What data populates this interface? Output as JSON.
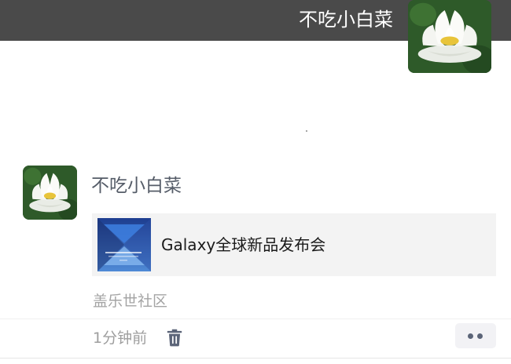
{
  "cover": {
    "name": "不吃小白菜",
    "avatar_icon": "white-lotus-avatar"
  },
  "post": {
    "author": "不吃小白菜",
    "avatar_icon": "white-lotus-avatar",
    "link": {
      "title": "Galaxy全球新品发布会",
      "thumbnail_icon": "galaxy-event-thumbnail"
    },
    "source": "盖乐世社区",
    "time": "1分钟前",
    "delete_icon": "trash-icon",
    "more_icon": "more-dots-icon"
  },
  "colors": {
    "cover_band": "#4a4a4a",
    "author_name": "#555c68",
    "link_card_bg": "#f3f3f3",
    "meta_text": "#a4a4a4",
    "action_accent": "#5b6478"
  }
}
